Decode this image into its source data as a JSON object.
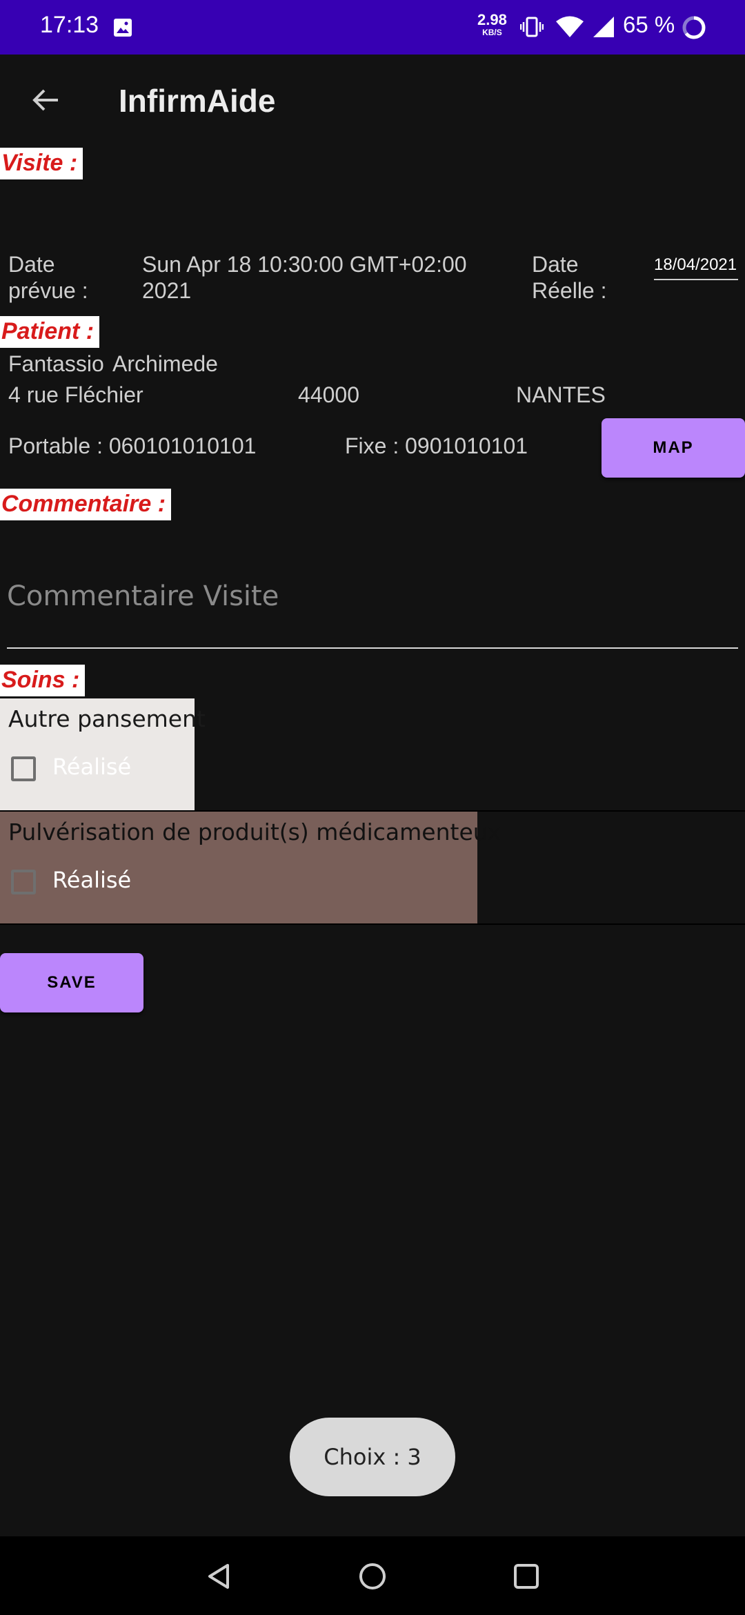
{
  "status_bar": {
    "time": "17:13",
    "net_speed_value": "2.98",
    "net_speed_unit": "KB/S",
    "battery": "65 %",
    "icons": [
      "image-icon",
      "vibrate-icon",
      "wifi-icon",
      "signal-icon",
      "battery-ring-icon"
    ]
  },
  "app_bar": {
    "title": "InfirmAide",
    "back_icon": "arrow-left-icon"
  },
  "visite": {
    "section_label": "Visite :",
    "date_prevue_label_line1": "Date",
    "date_prevue_label_line2": "prévue :",
    "date_prevue_line1": "Sun Apr 18 10:30:00 GMT+02:00",
    "date_prevue_line2": "2021",
    "date_reelle_label_line1": "Date",
    "date_reelle_label_line2": "Réelle :",
    "date_reelle_value": "18/04/2021"
  },
  "patient": {
    "section_label": "Patient :",
    "first_name": "Fantassio",
    "last_name": "Archimede",
    "street": "4 rue Fléchier",
    "postal_code": "44000",
    "city": "NANTES",
    "mobile": "Portable : 060101010101",
    "landline": "Fixe : 0901010101",
    "map_button": "MAP"
  },
  "commentaire": {
    "section_label": "Commentaire :",
    "placeholder": "Commentaire Visite",
    "value": ""
  },
  "soins": {
    "section_label": "Soins :",
    "items": [
      {
        "title": "Autre pansement",
        "checkbox_label": "Réalisé",
        "checked": false,
        "bg": "#ebe8e6"
      },
      {
        "title": "Pulvérisation de produit(s) médicamenteux",
        "checkbox_label": "Réalisé",
        "checked": false,
        "bg": "#795f59"
      }
    ]
  },
  "save_button": "SAVE",
  "toast": "Choix : 3",
  "colors": {
    "status_bar": "#3700b3",
    "background": "#121212",
    "accent": "#bb86fc",
    "section_label_text": "#d81b1b"
  },
  "nav_bar": {
    "icons": [
      "nav-back-icon",
      "nav-home-icon",
      "nav-recents-icon"
    ]
  }
}
